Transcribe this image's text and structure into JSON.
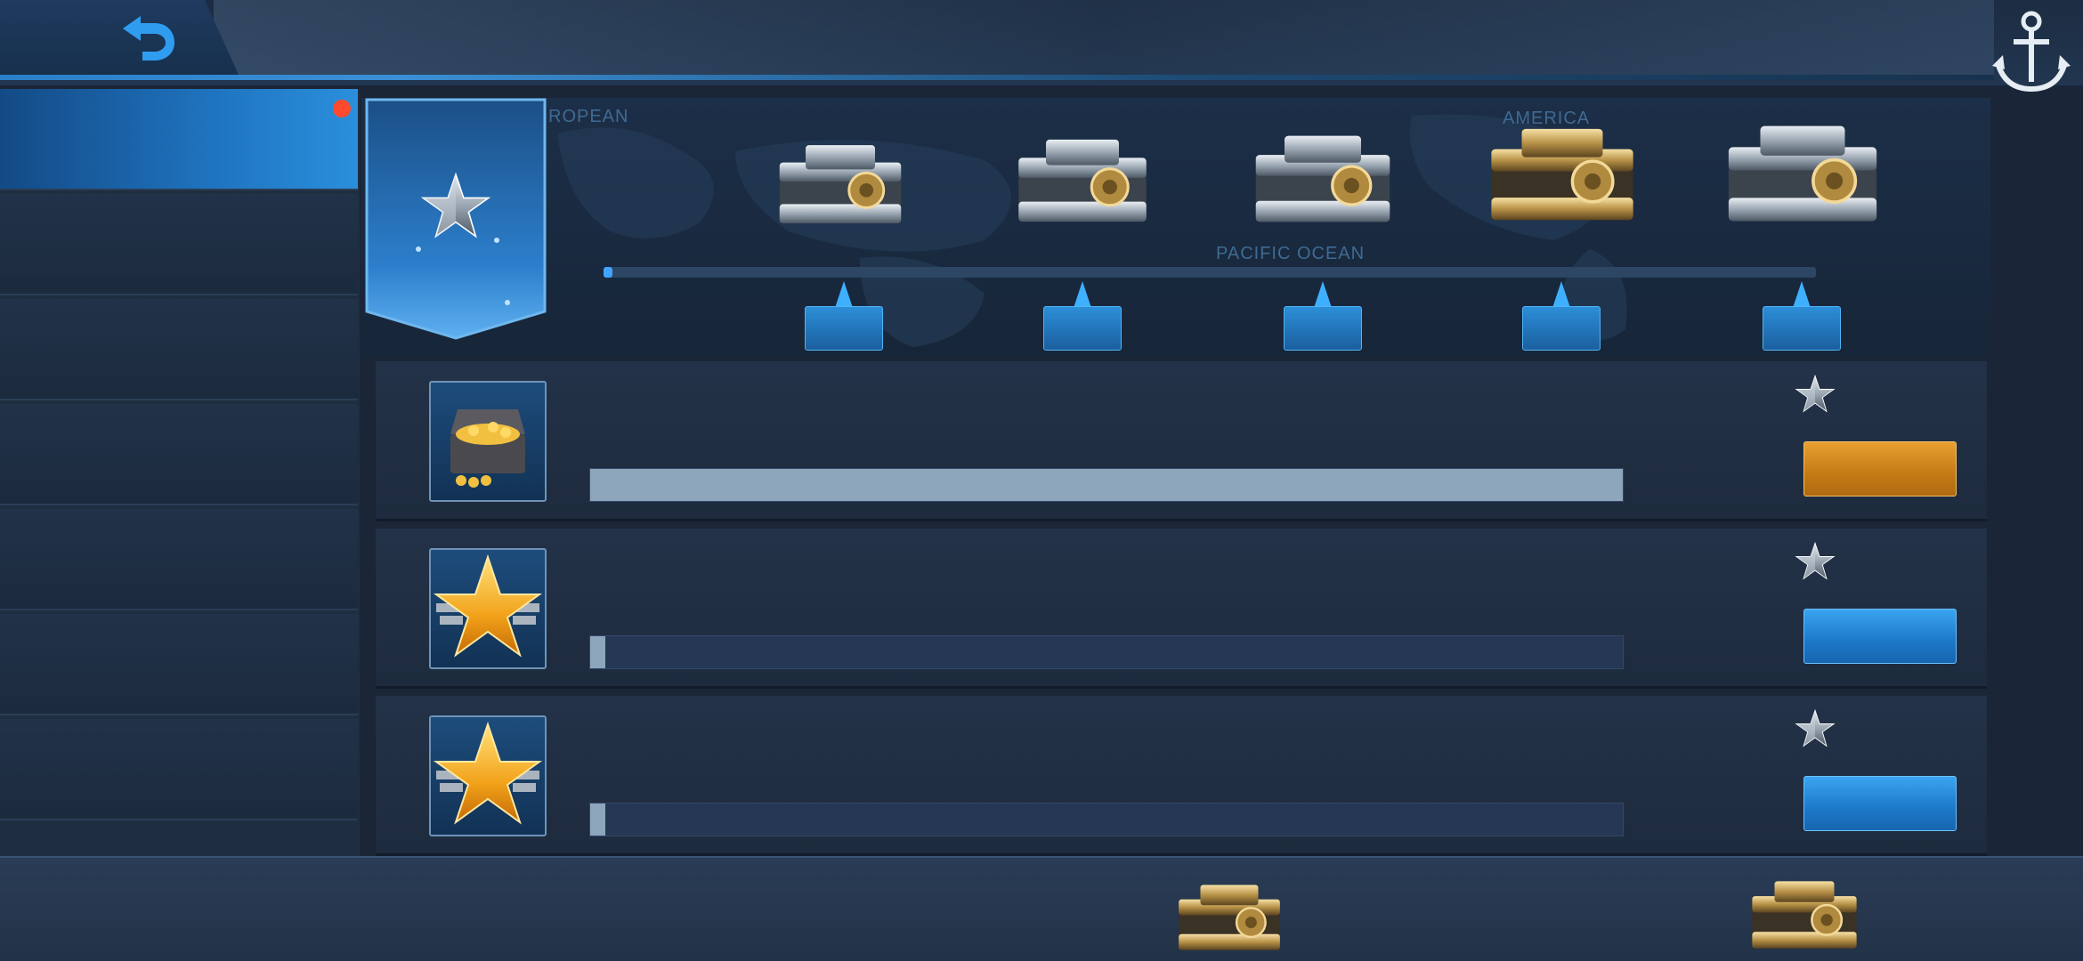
{
  "topbar": {
    "back_icon": "back-arrow-icon",
    "anchor_icon": "anchor-icon"
  },
  "sidebar": {
    "items": [
      {
        "active": true,
        "badge": true
      },
      {
        "active": false,
        "badge": false
      },
      {
        "active": false,
        "badge": false
      },
      {
        "active": false,
        "badge": false
      },
      {
        "active": false,
        "badge": false
      },
      {
        "active": false,
        "badge": false
      },
      {
        "active": false,
        "badge": false
      }
    ]
  },
  "reward_track": {
    "map_labels": [
      "ROPEAN",
      "AMERICA",
      "PACIFIC OCEAN"
    ],
    "progress": 0.005,
    "chests": [
      "chest-tier-1",
      "chest-tier-2",
      "chest-tier-3",
      "chest-tier-4",
      "chest-tier-5"
    ]
  },
  "tasks": [
    {
      "icon": "treasure-chest-icon",
      "progress": 1.0,
      "button": "gold"
    },
    {
      "icon": "gold-star-icon",
      "progress": 0.015,
      "button": "blue"
    },
    {
      "icon": "gold-star-icon",
      "progress": 0.015,
      "button": "blue"
    }
  ],
  "bottom": {
    "chests": [
      "chest-tier-4",
      "chest-tier-4"
    ]
  },
  "colors": {
    "accent": "#2a8fdc",
    "gold": "#e8a032",
    "badge": "#ff4a2e"
  }
}
